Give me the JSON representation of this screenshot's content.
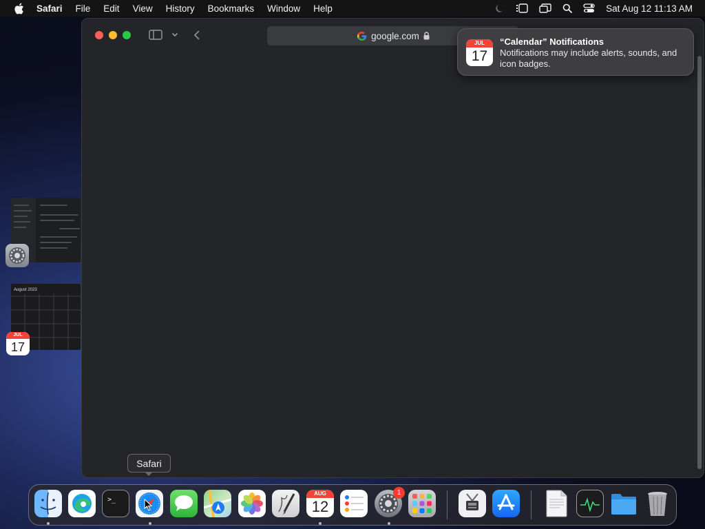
{
  "menubar": {
    "app_name": "Safari",
    "items": [
      "File",
      "Edit",
      "View",
      "History",
      "Bookmarks",
      "Window",
      "Help"
    ],
    "clock": "Sat Aug 12  11:13 AM"
  },
  "window": {
    "url": "google.com"
  },
  "notification": {
    "title": "“Calendar” Notifications",
    "body": "Notifications may include alerts, sounds, and icon badges.",
    "icon_month": "JUL",
    "icon_day": "17"
  },
  "spaces": {
    "calendar_thumb_title": "August 2023",
    "calendar_icon_month": "JUL",
    "calendar_icon_day": "17"
  },
  "dock": {
    "tooltip": "Safari",
    "calendar_month": "AUG",
    "calendar_day": "12",
    "settings_badge": "1",
    "apps": [
      "Finder",
      "Microsoft Edge",
      "Terminal",
      "Safari",
      "Messages",
      "Maps",
      "Photos",
      "Script Editor",
      "Calendar",
      "Reminders",
      "System Settings",
      "Launchpad",
      "System Information",
      "App Store",
      "TextEdit Document",
      "Activity Monitor",
      "Folder",
      "Trash"
    ]
  }
}
